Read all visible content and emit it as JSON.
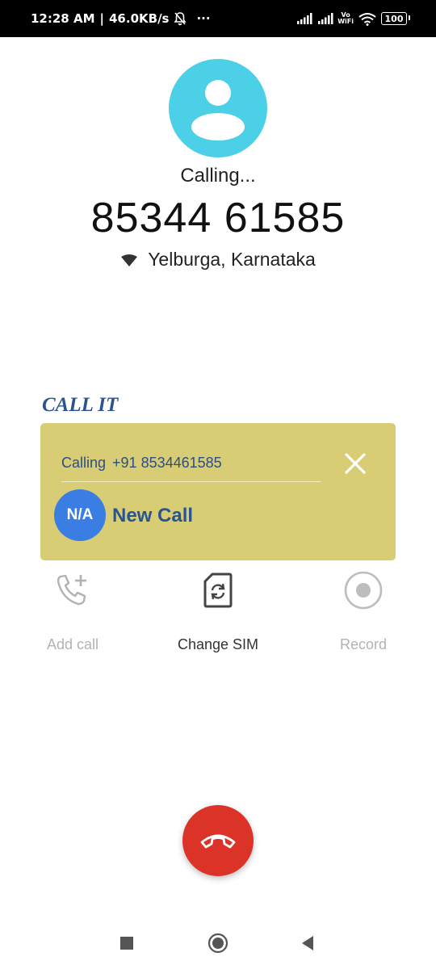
{
  "status_bar": {
    "time": "12:28 AM",
    "network_speed": "46.0KB/s",
    "more": "···",
    "volte_top": "Vo",
    "volte_bottom": "WiFi",
    "battery": "100",
    "icons": [
      "silent-bell-icon",
      "signal-icon",
      "signal-icon",
      "wifi-icon",
      "battery-icon"
    ]
  },
  "call": {
    "status": "Calling...",
    "number": "85344 61585",
    "location": "Yelburga, Karnataka",
    "avatar_color": "#4cd0e8"
  },
  "overlay": {
    "brand": "CALL IT",
    "calling_label": "Calling",
    "calling_number": "+91 8534461585",
    "badge": "N/A",
    "title": "New Call",
    "background": "#d8cd74",
    "badge_color": "#3b7ee3",
    "text_color": "#2a5490"
  },
  "actions": {
    "add_call": "Add call",
    "change_sim": "Change SIM",
    "record": "Record"
  },
  "end_call": {
    "color": "#dc3329",
    "icon": "hang-up-icon"
  },
  "nav": {
    "icons": [
      "recents-icon",
      "home-icon",
      "back-icon"
    ]
  }
}
